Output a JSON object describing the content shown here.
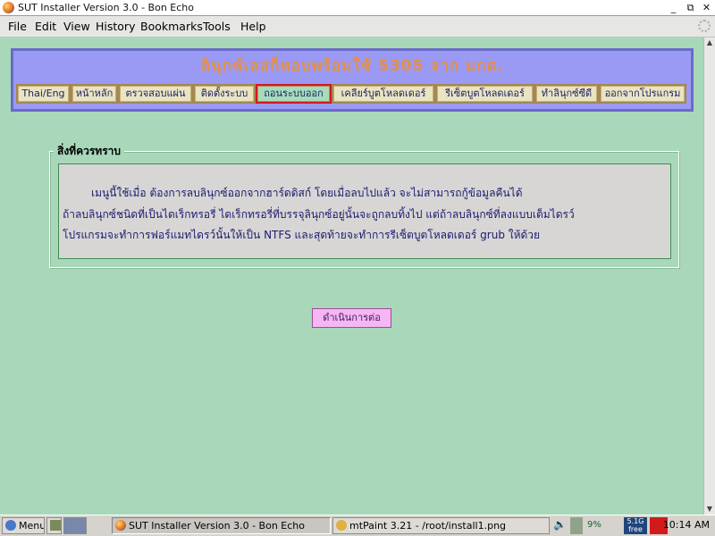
{
  "window": {
    "title": "SUT Installer Version 3.0 - Bon Echo",
    "controls": [
      "_",
      "⧉",
      "✕"
    ]
  },
  "menubar": {
    "items": [
      "File",
      "Edit",
      "View",
      "History",
      "Bookmarks",
      "Tools",
      "Help"
    ]
  },
  "page": {
    "banner_title": "ลินุกซ์เลสก็หอบพร้อมใช้ 5305 จาก มกส.",
    "nav": [
      "Thai/Eng",
      "หน้าหลัก",
      "ตรวจสอบแผ่น",
      "ติดตั้งระบบ",
      "ถอนระบบออก",
      "เคลียร์บูตโหลดเดอร์",
      "รีเซ็ตบูตโหลดเดอร์",
      "ทำลินุกซ์ซีดี",
      "ออกจากโปรแกรม"
    ],
    "nav_active": "ถอนระบบออก",
    "notice_legend": "สิ่งที่ควรทราบ",
    "notice_lines": [
      "เมนูนี้ใช้เมื่อ ต้องการลบลินุกซ์ออกจากฮาร์ดดิสก์ โดยเมื่อลบไปแล้ว จะไม่สามารถกู้ข้อมูลคืนได้",
      "ถ้าลบลินุกซ์ชนิดที่เป็นไดเร็กทรอรี่ ไดเร็กทรอรี่ที่บรรจุลินุกซ์อยู่นั้นจะถูกลบทิ้งไป แต่ถ้าลบลินุกซ์ที่ลงแบบเต็มไดรว์",
      "โปรแกรมจะทำการฟอร์แมทไดรว์นั้นให้เป็น NTFS และสุดท้ายจะทำการรีเซ็ตบูตโหลดเดอร์ grub ให้ด้วย"
    ],
    "continue_label": "ดำเนินการต่อ"
  },
  "taskbar": {
    "menu_label": "Menu",
    "tasks": [
      "SUT Installer Version 3.0 - Bon Echo",
      "mtPaint 3.21 - /root/install1.png"
    ],
    "cpu_label": "9%",
    "mem_label": "5.1G free",
    "clock": "10:14 AM"
  },
  "colors": {
    "content_bg": "#a8d8b9",
    "banner_bg": "#9a9af4",
    "banner_text": "#e58f45",
    "active_border": "#d21a1a"
  }
}
